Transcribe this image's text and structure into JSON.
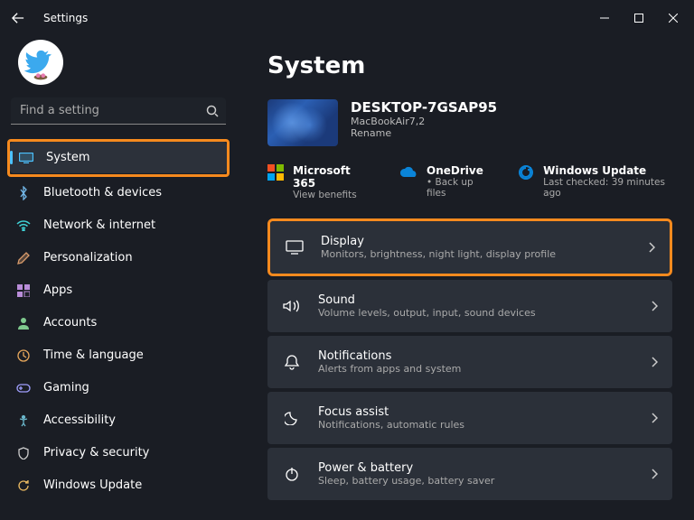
{
  "titlebar": {
    "title": "Settings"
  },
  "search": {
    "placeholder": "Find a setting"
  },
  "sidebar": {
    "items": [
      {
        "label": "System"
      },
      {
        "label": "Bluetooth & devices"
      },
      {
        "label": "Network & internet"
      },
      {
        "label": "Personalization"
      },
      {
        "label": "Apps"
      },
      {
        "label": "Accounts"
      },
      {
        "label": "Time & language"
      },
      {
        "label": "Gaming"
      },
      {
        "label": "Accessibility"
      },
      {
        "label": "Privacy & security"
      },
      {
        "label": "Windows Update"
      }
    ]
  },
  "page": {
    "title": "System"
  },
  "device": {
    "name": "DESKTOP-7GSAP95",
    "model": "MacBookAir7,2",
    "rename": "Rename"
  },
  "promos": {
    "ms365": {
      "title": "Microsoft 365",
      "sub": "View benefits"
    },
    "onedrive": {
      "title": "OneDrive",
      "sub": "Back up files"
    },
    "update": {
      "title": "Windows Update",
      "sub": "Last checked: 39 minutes ago"
    }
  },
  "cards": {
    "display": {
      "title": "Display",
      "desc": "Monitors, brightness, night light, display profile"
    },
    "sound": {
      "title": "Sound",
      "desc": "Volume levels, output, input, sound devices"
    },
    "notifications": {
      "title": "Notifications",
      "desc": "Alerts from apps and system"
    },
    "focus": {
      "title": "Focus assist",
      "desc": "Notifications, automatic rules"
    },
    "power": {
      "title": "Power & battery",
      "desc": "Sleep, battery usage, battery saver"
    }
  }
}
